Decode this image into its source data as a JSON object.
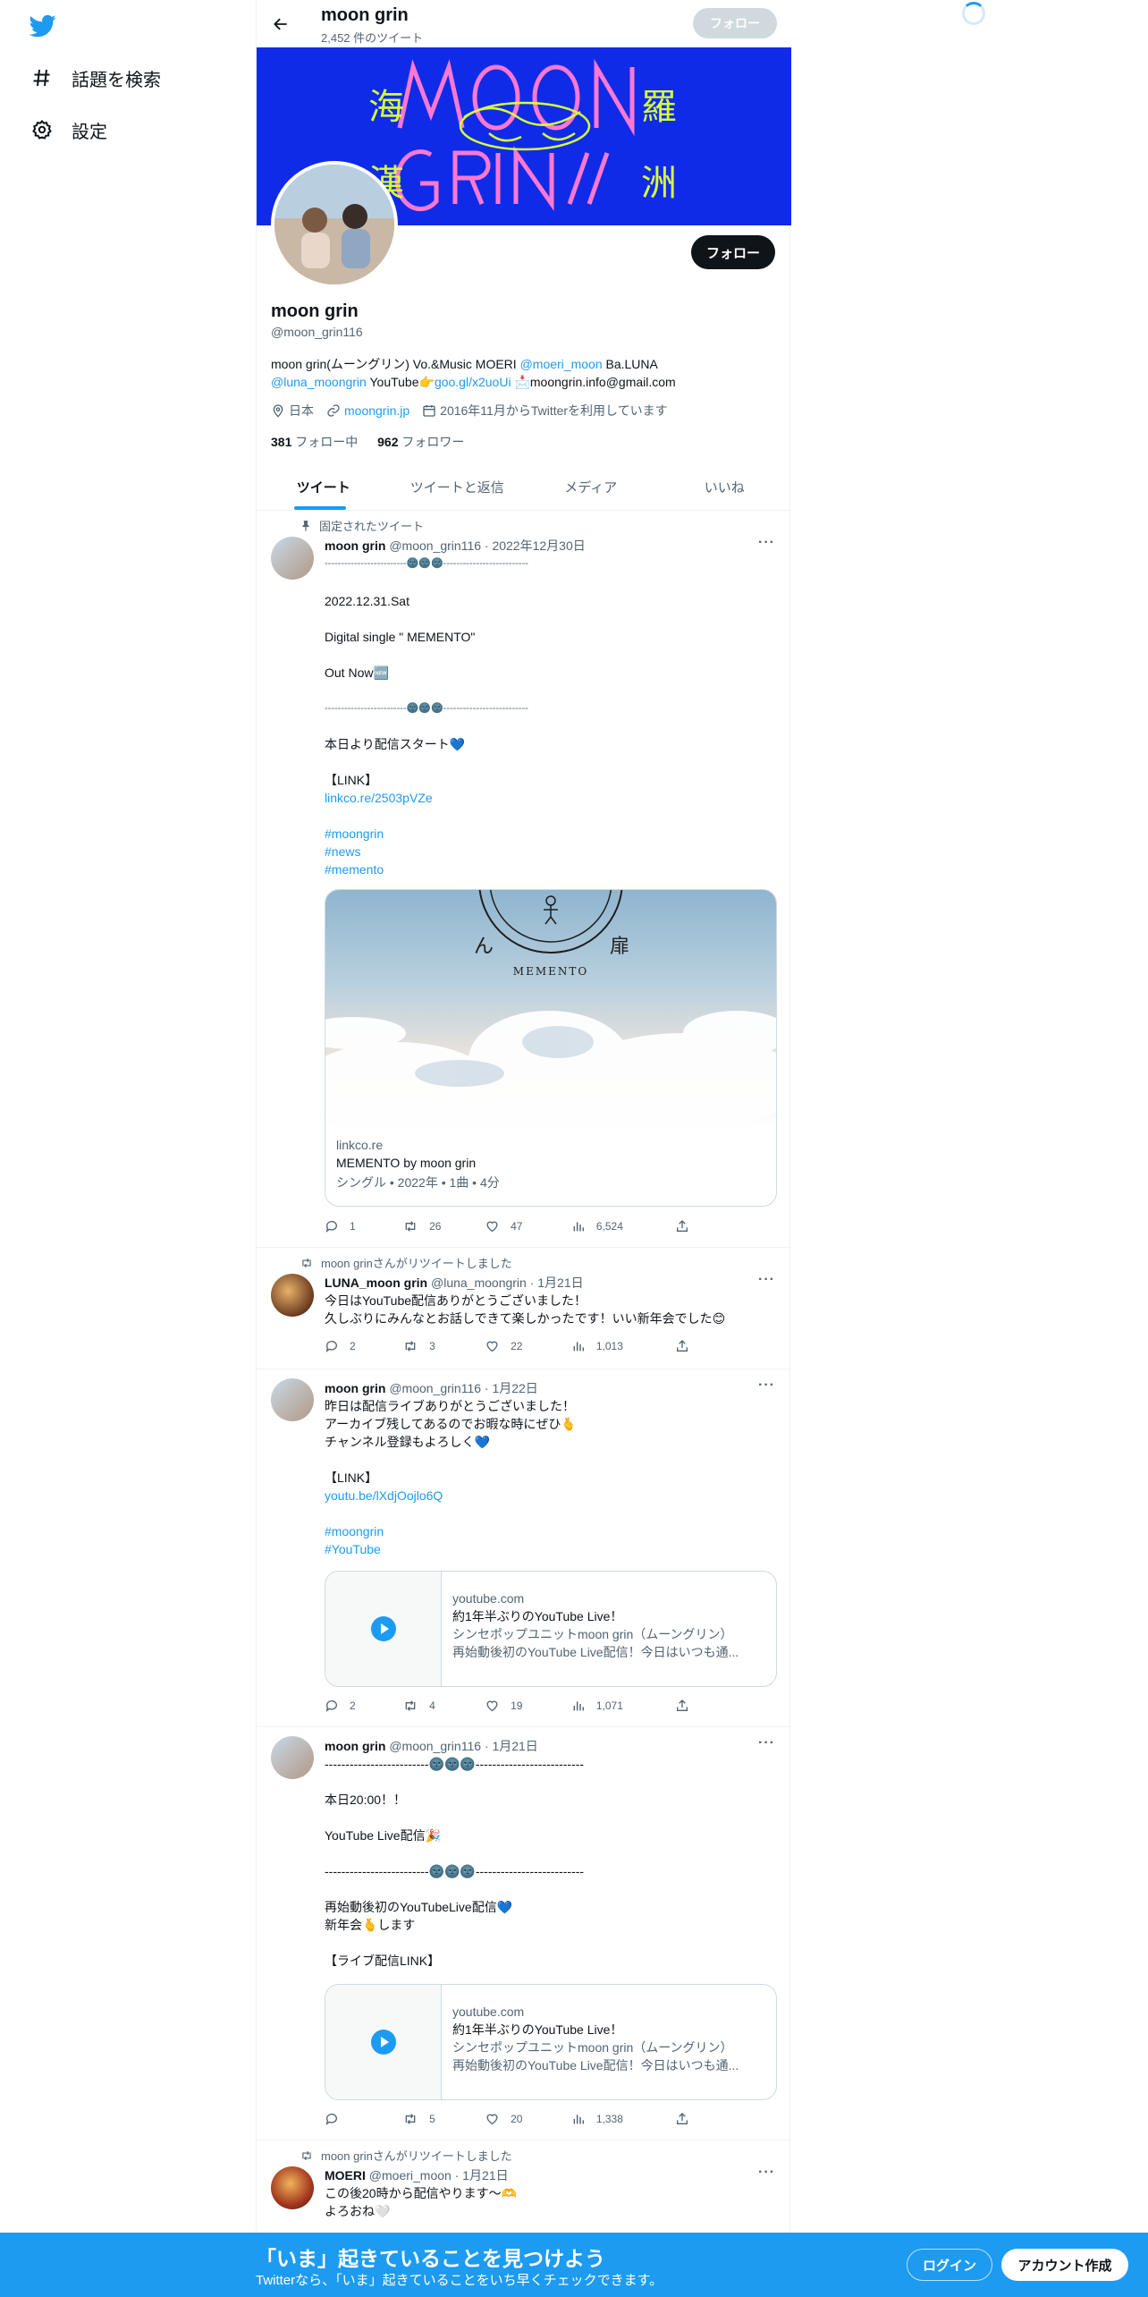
{
  "nav": {
    "explore_label": "話題を検索",
    "settings_label": "設定"
  },
  "header": {
    "title": "moon grin",
    "tweet_count": "2,452 件のツイート",
    "follow_label": "フォロー"
  },
  "banner": {
    "text_top": "MOON",
    "text_bottom": "GRIN//",
    "kanji": [
      "海",
      "羅",
      "漢",
      "洲"
    ]
  },
  "profile": {
    "name": "moon grin",
    "handle": "@moon_grin116",
    "follow_label": "フォロー",
    "bio_line1_a": "moon grin(ムーングリン) Vo.&Music MOERI ",
    "bio_mention1": "@moeri_moon",
    "bio_line1_b": " Ba.LUNA",
    "bio_mention2": "@luna_moongrin",
    "bio_line2_a": " YouTube👉",
    "bio_link": "goo.gl/x2uoUi",
    "bio_line2_b": " 📩moongrin.info@gmail.com",
    "location": "日本",
    "website": "moongrin.jp",
    "joined": "2016年11月からTwitterを利用しています",
    "following_count": "381",
    "following_label": " フォロー中",
    "followers_count": "962",
    "followers_label": " フォロワー"
  },
  "tabs": [
    "ツイート",
    "ツイートと返信",
    "メディア",
    "いいね"
  ],
  "tweets": [
    {
      "context": "固定されたツイート",
      "name": "moon grin",
      "meta": " @moon_grin116 · 2022年12月30日",
      "sep": "-------------------------🌚🌚🌚--------------------------",
      "l1": "2022.12.31.Sat",
      "l2": "Digital single \" MEMENTO\"",
      "l3": "Out Now🆕",
      "sep2": "-------------------------🌚🌚🌚--------------------------",
      "l4": "本日より配信スタート💙",
      "l5": "【LINK】",
      "link": "linkco.re/2503pVZe",
      "tag1": "#moongrin",
      "tag2": "#news",
      "tag3": "#memento",
      "card_glyphs": [
        "ん",
        "扉"
      ],
      "card_caption": "MEMENTO",
      "card_domain": "linkco.re",
      "card_title": "MEMENTO by moon grin",
      "card_sub": "シングル • 2022年 • 1曲 • 4分",
      "replies": "1",
      "retweets": "26",
      "likes": "47",
      "views": "6,524"
    },
    {
      "context": "moon grinさんがリツイートしました",
      "name": "LUNA_moon grin",
      "meta": " @luna_moongrin · 1月21日",
      "text": "今日はYouTube配信ありがとうございました！\n久しぶりにみんなとお話しできて楽しかったです！いい新年会でした😊",
      "replies": "2",
      "retweets": "3",
      "likes": "22",
      "views": "1,013"
    },
    {
      "name": "moon grin",
      "meta": " @moon_grin116 · 1月22日",
      "text": "昨日は配信ライブありがとうございました！\nアーカイブ残してあるのでお暇な時にぜひ🫰\nチャンネル登録もよろしく💙\n\n【LINK】",
      "link": "youtu.be/lXdjOojlo6Q",
      "tag1": "#moongrin",
      "tag2": "#YouTube",
      "card_domain": "youtube.com",
      "card_title": "約1年半ぶりのYouTube Live！",
      "card_sub1": "シンセポップユニットmoon grin（ムーングリン）",
      "card_sub2": "再始動後初のYouTube Live配信！今日はいつも通...",
      "replies": "2",
      "retweets": "4",
      "likes": "19",
      "views": "1,071"
    },
    {
      "name": "moon grin",
      "meta": " @moon_grin116 · 1月21日",
      "text": "-------------------------🌚🌚🌚--------------------------\n\n本日20:00！！\n\nYouTube Live配信🎉\n\n-------------------------🌚🌚🌚--------------------------\n\n再始動後初のYouTubeLive配信💙\n新年会🫰します\n\n【ライブ配信LINK】",
      "card_domain": "youtube.com",
      "card_title": "約1年半ぶりのYouTube Live！",
      "card_sub1": "シンセポップユニットmoon grin（ムーングリン）",
      "card_sub2": "再始動後初のYouTube Live配信！今日はいつも通...",
      "replies": "",
      "retweets": "5",
      "likes": "20",
      "views": "1,338"
    },
    {
      "context": "moon grinさんがリツイートしました",
      "name": "MOERI",
      "meta": " @moeri_moon · 1月21日",
      "text": "この後20時から配信やります〜🫶\nよろおね🤍"
    }
  ],
  "bottom": {
    "title": "「いま」起きていることを見つけよう",
    "subtitle": "Twitterなら、「いま」起きていることをいち早くチェックできます。",
    "login_label": "ログイン",
    "signup_label": "アカウント作成"
  },
  "colors": {
    "accent": "#1d9bf0",
    "banner_bg": "#0f2be8",
    "banner_text": "#ff78d2",
    "text": "#0f1419",
    "secondary": "#536471"
  }
}
